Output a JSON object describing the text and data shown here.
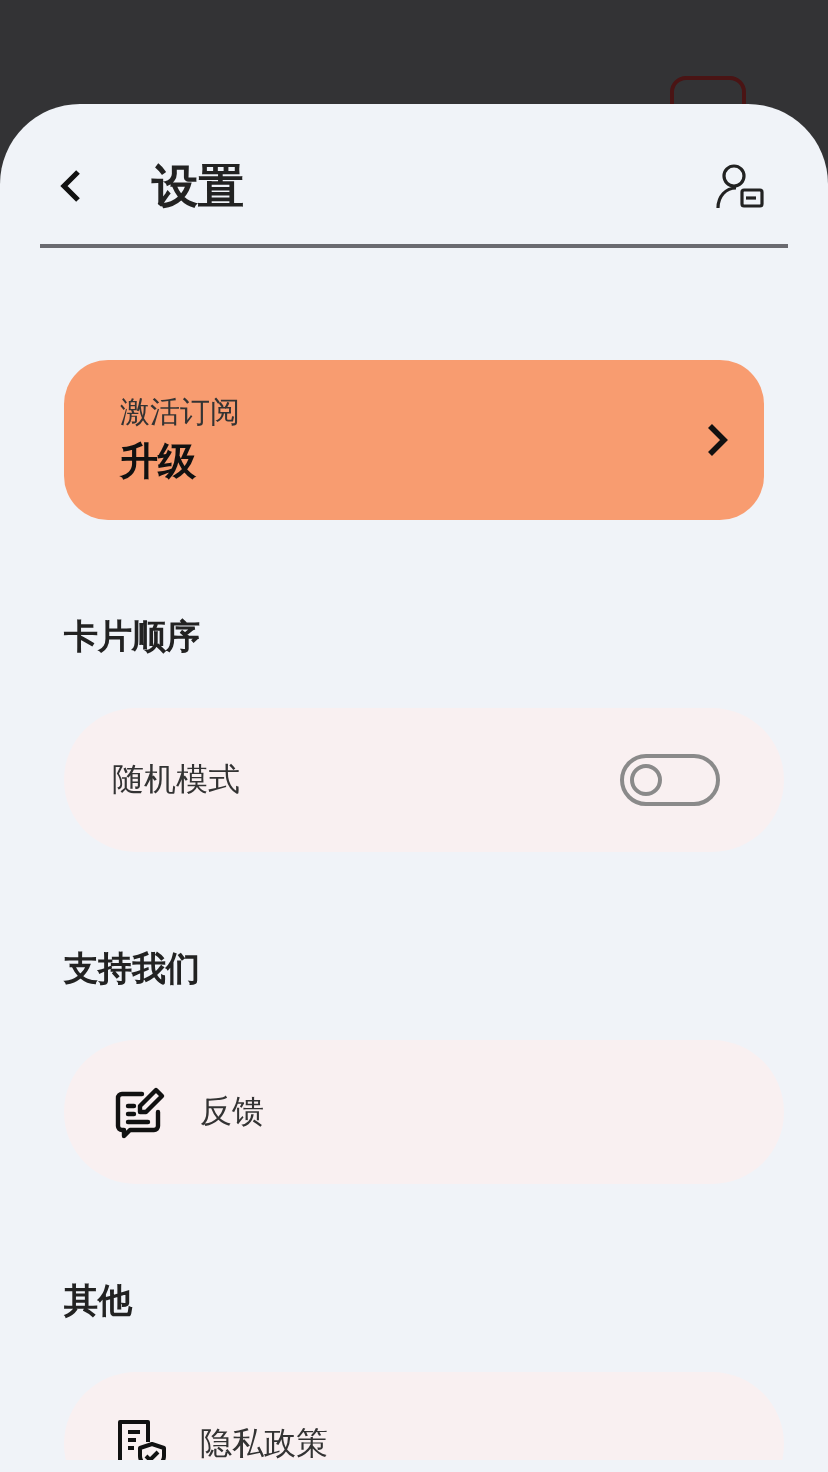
{
  "header": {
    "title": "设置"
  },
  "upgrade": {
    "subtitle": "激活订阅",
    "title": "升级"
  },
  "sections": [
    {
      "title": "卡片顺序",
      "items": [
        {
          "kind": "toggle",
          "label": "随机模式",
          "on": false
        }
      ]
    },
    {
      "title": "支持我们",
      "items": [
        {
          "kind": "feedback",
          "label": "反馈"
        }
      ]
    },
    {
      "title": "其他",
      "items": [
        {
          "kind": "privacy",
          "label": "隐私政策"
        }
      ]
    }
  ]
}
